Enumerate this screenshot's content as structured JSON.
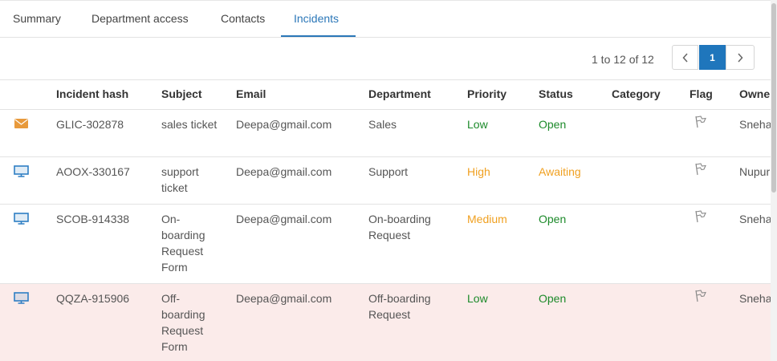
{
  "tabs": [
    {
      "label": "Summary",
      "active": false
    },
    {
      "label": "Department access",
      "active": false
    },
    {
      "label": "Contacts",
      "active": false
    },
    {
      "label": "Incidents",
      "active": true
    }
  ],
  "pagination": {
    "range_text": "1 to 12 of 12",
    "current_page": "1"
  },
  "table": {
    "columns": [
      "Incident hash",
      "Subject",
      "Email",
      "Department",
      "Priority",
      "Status",
      "Category",
      "Flag",
      "Owner"
    ],
    "rows": [
      {
        "channel_icon": "envelope-icon",
        "hash": "GLIC-302878",
        "subject": "sales ticket",
        "email": "Deepa@gmail.com",
        "department": "Sales",
        "priority": "Low",
        "status": "Open",
        "category": "",
        "owner": "Sneha"
      },
      {
        "channel_icon": "monitor-icon",
        "hash": "AOOX-330167",
        "subject": "support ticket",
        "email": "Deepa@gmail.com",
        "department": "Support",
        "priority": "High",
        "status": "Awaiting",
        "category": "",
        "owner": "Nupur"
      },
      {
        "channel_icon": "monitor-icon",
        "hash": "SCOB-914338",
        "subject": "On-boarding Request Form",
        "email": "Deepa@gmail.com",
        "department": "On-boarding Request",
        "priority": "Medium",
        "status": "Open",
        "category": "",
        "owner": "Sneha"
      },
      {
        "channel_icon": "monitor-icon",
        "hash": "QQZA-915906",
        "subject": "Off-boarding Request Form",
        "email": "Deepa@gmail.com",
        "department": "Off-boarding Request",
        "priority": "Low",
        "status": "Open",
        "category": "",
        "owner": "Sneha"
      }
    ]
  },
  "colors": {
    "accent": "#2b77b8",
    "page_active_bg": "#1f76bc",
    "priority_low": "#1c8a2a",
    "priority_high": "#f0a020",
    "status_open": "#1c8a2a",
    "status_awaiting": "#f0a020",
    "highlight_row_bg": "#fbebea",
    "envelope_icon": "#e89a3c",
    "monitor_icon": "#2e7ec4"
  }
}
